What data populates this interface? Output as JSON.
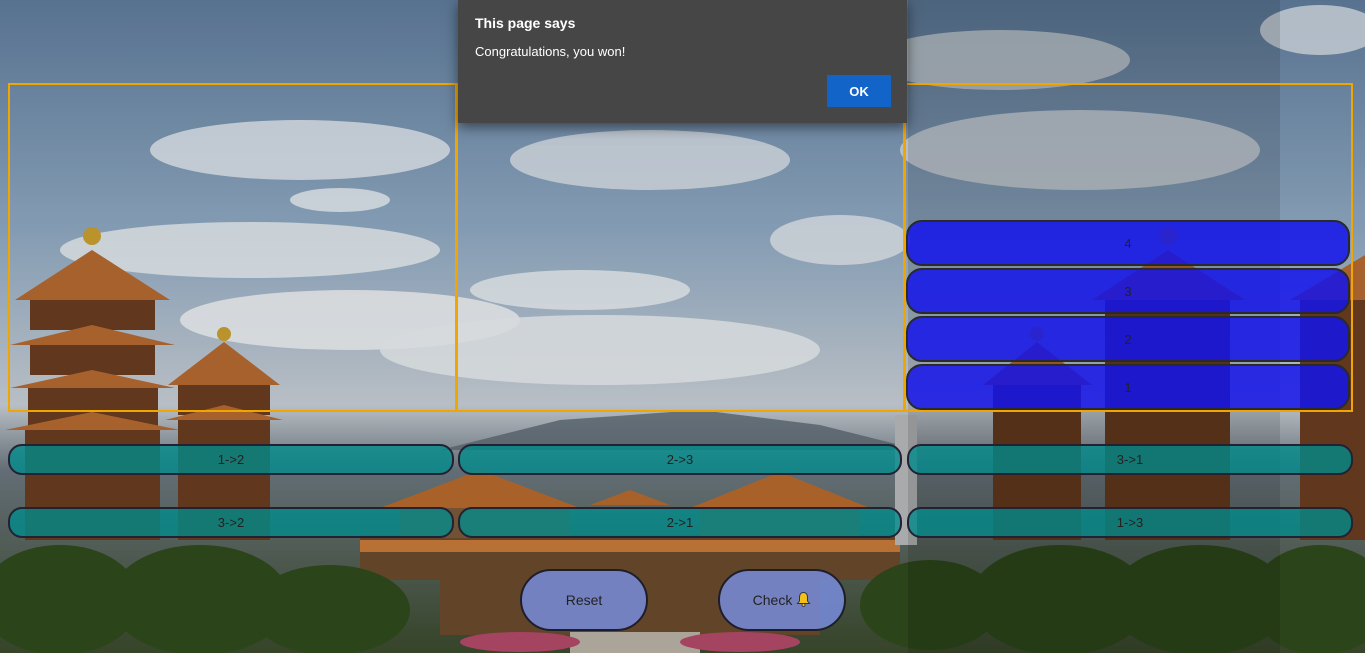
{
  "dialog": {
    "title": "This page says",
    "message": "Congratulations, you won!",
    "ok_label": "OK"
  },
  "towers": [
    {
      "id": 1,
      "disks": []
    },
    {
      "id": 2,
      "disks": []
    },
    {
      "id": 3,
      "disks": [
        "4",
        "3",
        "2",
        "1"
      ]
    }
  ],
  "moves_row1": [
    "1->2",
    "2->3",
    "3->1"
  ],
  "moves_row2": [
    "3->2",
    "2->1",
    "1->3"
  ],
  "controls": {
    "reset_label": "Reset",
    "check_label": "Check",
    "check_icon": "bell-icon"
  },
  "colors": {
    "tower_border": "#f0a500",
    "disk": "#1414eb",
    "move_button": "#008c8c",
    "control_button": "#788cdc",
    "dialog_bg": "#464646",
    "ok_button": "#1264c8"
  }
}
